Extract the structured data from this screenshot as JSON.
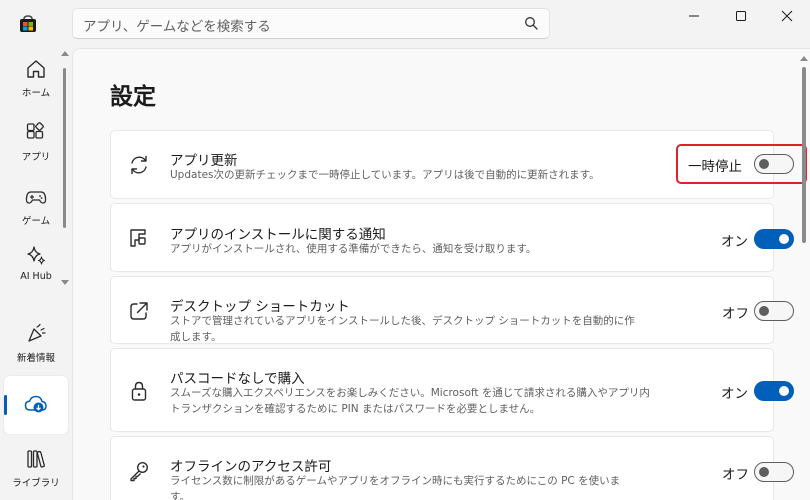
{
  "search": {
    "placeholder": "アプリ、ゲームなどを検索する"
  },
  "nav": {
    "home": "ホーム",
    "apps": "アプリ",
    "games": "ゲーム",
    "ai_hub": "AI Hub",
    "whats_new": "新着情報",
    "library": "ライブラリ"
  },
  "page": {
    "title": "設定"
  },
  "settings": [
    {
      "title": "アプリ更新",
      "desc": "Updates次の更新チェックまで一時停止しています。アプリは後で自動的に更新されます。",
      "state": "一時停止",
      "toggle": "off"
    },
    {
      "title": "アプリのインストールに関する通知",
      "desc": "アプリがインストールされ、使用する準備ができたら、通知を受け取ります。",
      "state": "オン",
      "toggle": "on"
    },
    {
      "title": "デスクトップ ショートカット",
      "desc": "ストアで管理されているアプリをインストールした後、デスクトップ ショートカットを自動的に作成します。",
      "state": "オフ",
      "toggle": "off"
    },
    {
      "title": "パスコードなしで購入",
      "desc": "スムーズな購入エクスペリエンスをお楽しみください。Microsoft を通じて請求される購入やアプリ内トランザクションを確認するために PIN またはパスワードを必要としません。",
      "state": "オン",
      "toggle": "on"
    },
    {
      "title": "オフラインのアクセス許可",
      "desc": "ライセンス数に制限があるゲームやアプリをオフライン時にも実行するためにこの PC を使います。",
      "state": "オフ",
      "toggle": "off"
    }
  ],
  "colors": {
    "accent": "#005fb8",
    "highlight": "#e0202b"
  }
}
